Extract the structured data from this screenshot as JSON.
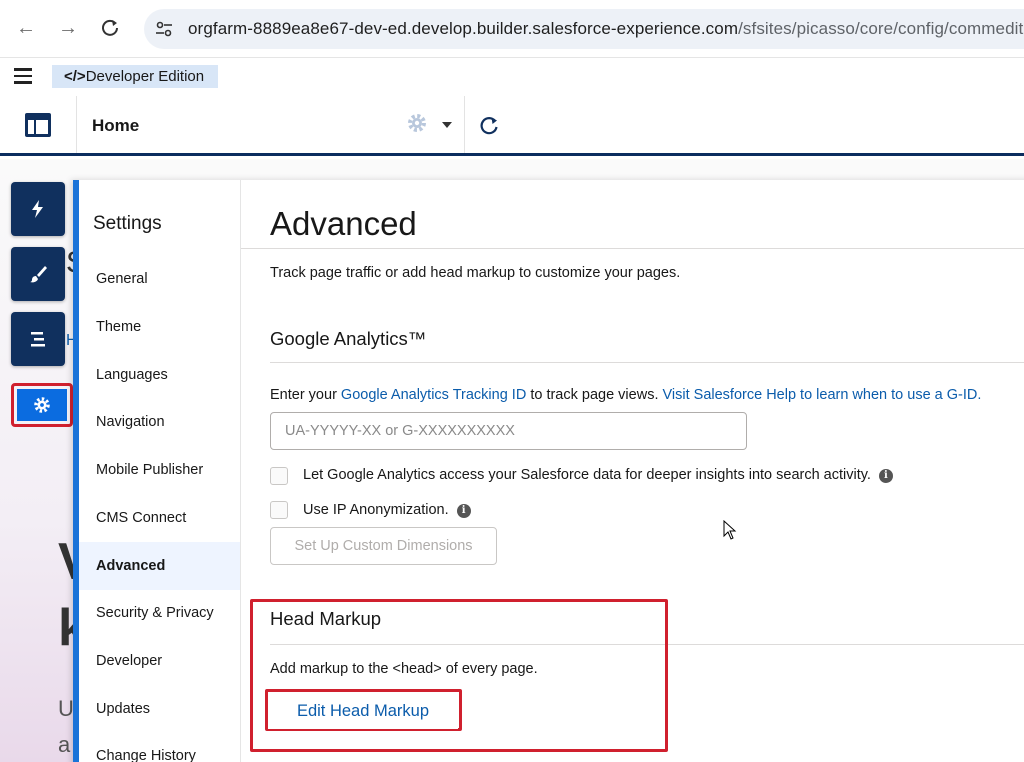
{
  "browser": {
    "url_main": "orgfarm-8889ea8e67-dev-ed.develop.builder.salesforce-experience.com",
    "url_path": "/sfsites/picasso/core/config/commeditor.j"
  },
  "builder": {
    "edition_label": "Developer Edition",
    "edition_prefix": "</>",
    "page_name": "Home"
  },
  "canvas_peek": {
    "a": "S",
    "b": "H",
    "c": "V",
    "d": "k",
    "e": "U",
    "f": "a"
  },
  "settings_nav": {
    "title": "Settings",
    "items": [
      {
        "label": "General"
      },
      {
        "label": "Theme"
      },
      {
        "label": "Languages"
      },
      {
        "label": "Navigation"
      },
      {
        "label": "Mobile Publisher"
      },
      {
        "label": "CMS Connect"
      },
      {
        "label": "Advanced"
      },
      {
        "label": "Security & Privacy"
      },
      {
        "label": "Developer"
      },
      {
        "label": "Updates"
      },
      {
        "label": "Change History"
      }
    ],
    "active_index": 6
  },
  "advanced": {
    "title": "Advanced",
    "description": "Track page traffic or add head markup to customize your pages.",
    "google_analytics": {
      "heading": "Google Analytics™",
      "enter_prefix": "Enter your ",
      "tracking_link": "Google Analytics Tracking ID",
      "enter_middle": " to track page views. ",
      "help_link": "Visit Salesforce Help to learn when to use a G-ID.",
      "input_placeholder": "UA-YYYYY-XX or G-XXXXXXXXXX",
      "checkbox_search": "Let Google Analytics access your Salesforce data for deeper insights into search activity.",
      "checkbox_ip": "Use IP Anonymization.",
      "custom_dimensions_button": "Set Up Custom Dimensions"
    },
    "head_markup": {
      "heading": "Head Markup",
      "description": "Add markup to the <head> of every page.",
      "edit_button": "Edit Head Markup"
    }
  },
  "colors": {
    "highlight": "#d0202e",
    "nav_dark": "#10305e",
    "accent_blue": "#0b6ce0",
    "link": "#0b5cab"
  },
  "icons": {
    "toolbar": [
      "lightning-icon",
      "paintbrush-icon",
      "list-icon",
      "gear-icon"
    ]
  }
}
